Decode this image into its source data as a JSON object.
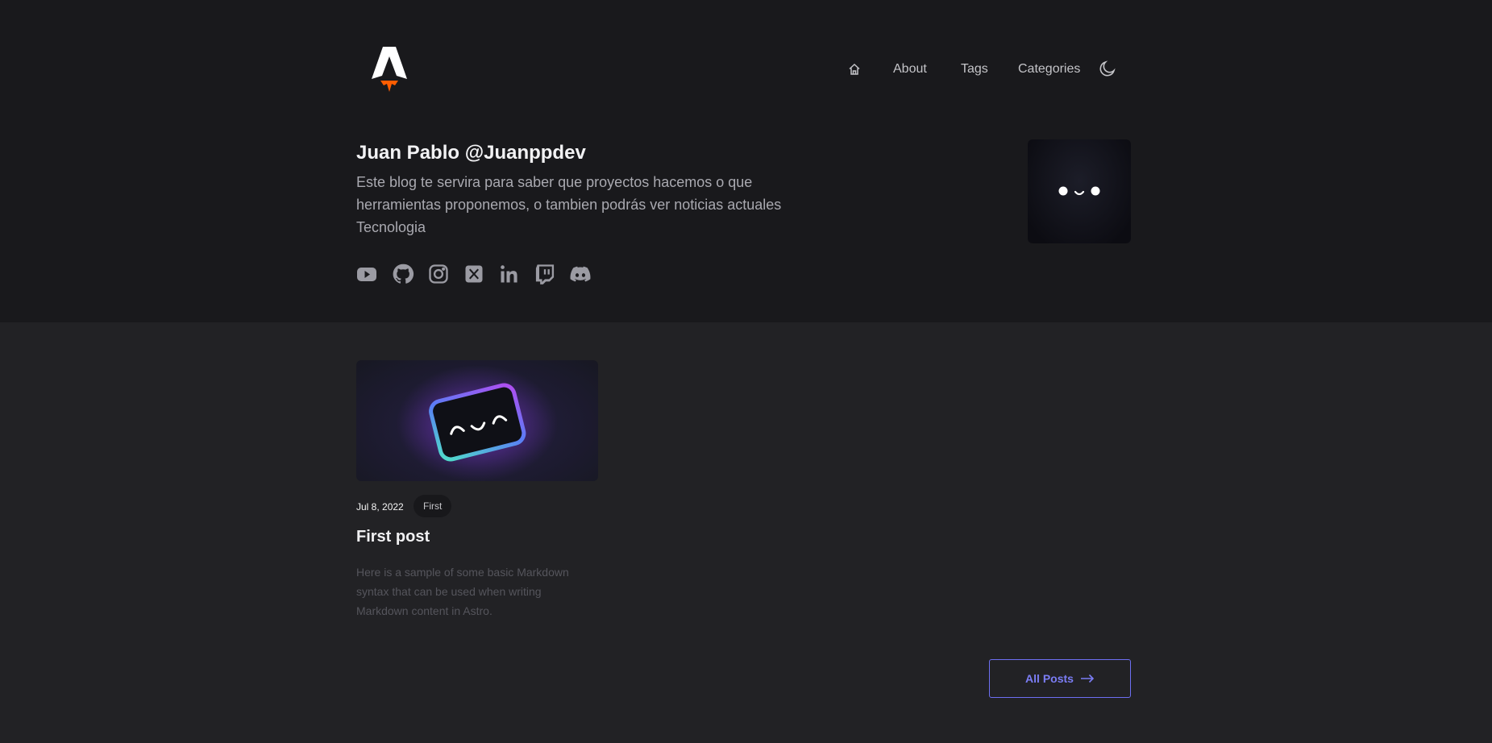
{
  "header": {
    "logo_icon": "astro-rocket-logo",
    "nav": {
      "home_icon": "home-icon",
      "about": "About",
      "tags": "Tags",
      "categories": "Categories",
      "theme_icon": "moon-icon"
    }
  },
  "hero": {
    "title": "Juan Pablo @Juanppdev",
    "bio": "Este blog te servira para saber que proyectos hacemos o que herramientas proponemos, o tambien podrás ver noticias actuales Tecnologia",
    "social_icons": [
      "youtube-icon",
      "github-icon",
      "instagram-icon",
      "x-icon",
      "linkedin-icon",
      "twitch-icon",
      "discord-icon"
    ],
    "avatar_icon": "face-avatar-icon"
  },
  "posts": [
    {
      "date": "Jul 8, 2022",
      "tag": "First",
      "title": "First post",
      "description": "Here is a sample of some basic Markdown syntax that can be used when writing Markdown content in Astro.",
      "image_icon": "smiling-card-icon"
    }
  ],
  "all_posts_label": "All Posts",
  "colors": {
    "hero_bg": "#19191c",
    "main_bg": "#222225",
    "accent": "#6d6ff2",
    "logo_flame": "#ff5d01"
  }
}
